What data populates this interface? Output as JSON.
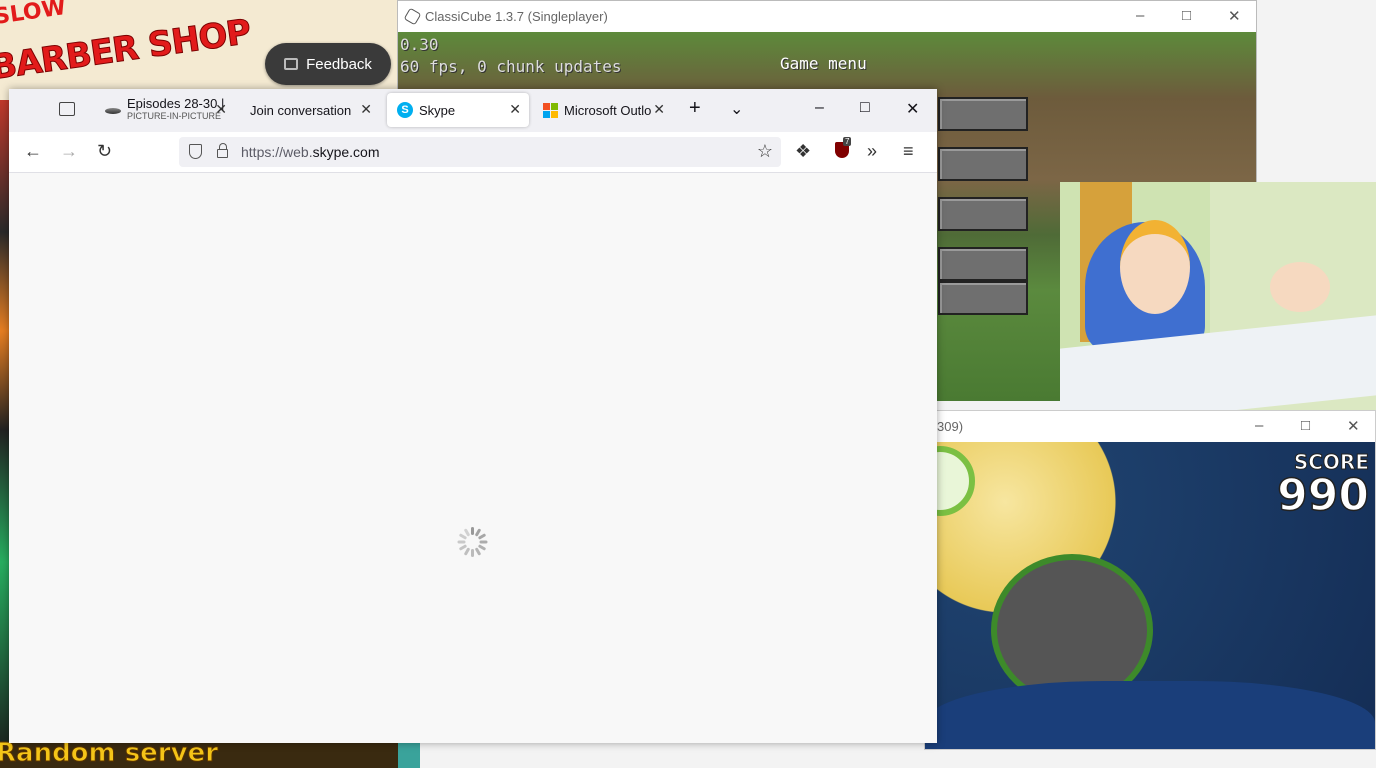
{
  "background_game": {
    "title_top": "SLOW",
    "title": "BARBER SHOP",
    "random_server": "Random server",
    "feedback_label": "Feedback"
  },
  "classicube": {
    "title": "ClassiCube 1.3.7 (Singleplayer)",
    "hud_line1": "0.30",
    "hud_line2": "60 fps, 0 chunk updates",
    "menu_title": "Game menu"
  },
  "angry_birds": {
    "title_fragment": "309)",
    "score_label": "SCORE",
    "score_value": "990"
  },
  "firefox": {
    "tabs": [
      {
        "label": "Episodes 28-30 |",
        "sub": "PICTURE-IN-PICTURE",
        "icon": "episodes-favicon"
      },
      {
        "label": "Join conversation",
        "icon": "none"
      },
      {
        "label": "Skype",
        "icon": "skype-favicon",
        "active": true
      },
      {
        "label": "Microsoft Outlo",
        "icon": "microsoft-favicon"
      }
    ],
    "url_prefix": "https://web.",
    "url_domain": "skype.com",
    "ublock_count": "7",
    "colors": {
      "skype": "#00aff0",
      "ms_red": "#f25022",
      "ms_green": "#7fba00",
      "ms_blue": "#00a4ef",
      "ms_yellow": "#ffb900"
    }
  }
}
